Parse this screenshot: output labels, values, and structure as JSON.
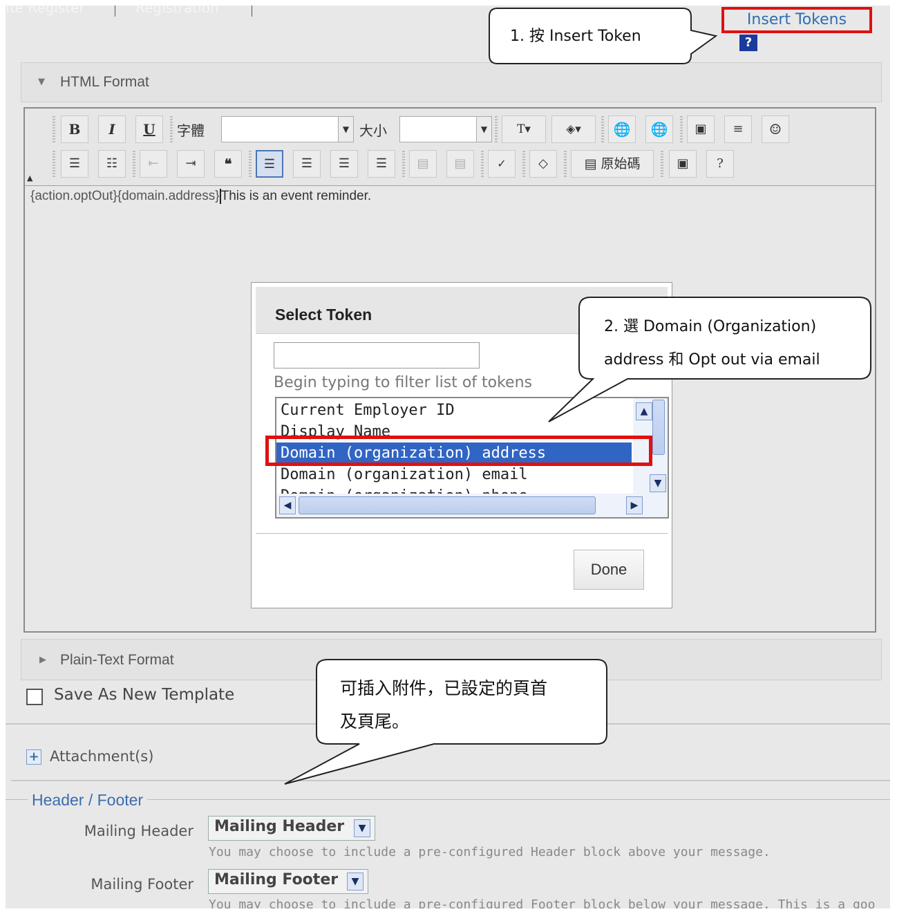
{
  "top_tabs": [
    "Ite Register",
    "Registration"
  ],
  "insert_tokens_label": "Insert Tokens",
  "help_icon_label": "?",
  "html_format_label": "HTML Format",
  "toolbar": {
    "bold": "B",
    "italic": "I",
    "underline": "U",
    "font_label": "字體",
    "size_label": "大小",
    "source_label": "原始碼",
    "quote": "❝"
  },
  "editor_content": {
    "token1": "{action.optOut}",
    "token2": "{domain.address}",
    "text": "This is an event reminder."
  },
  "dialog": {
    "title": "Select Token",
    "filter_value": "",
    "filter_hint": "Begin typing to filter list of tokens",
    "items": [
      "Current Employer ID",
      "Display Name",
      "Domain (organization) address",
      "Domain (organization) email",
      "Domain (organization) phone"
    ],
    "selected_index": 2,
    "done_label": "Done"
  },
  "callouts": {
    "c1": "1. 按 Insert Token",
    "c2_line1": "2. 選 Domain (Organization)",
    "c2_line2": "address 和 Opt out via email",
    "c3_line1": "可插入附件，已設定的頁首",
    "c3_line2": "及頁尾。"
  },
  "plain_text_label": "Plain-Text Format",
  "save_template_label": "Save As New Template",
  "attachments_label": "Attachment(s)",
  "header_footer": {
    "legend": "Header / Footer",
    "header_label": "Mailing Header",
    "header_value": "Mailing Header",
    "header_help": "You may choose to include a pre-configured Header block above your message.",
    "footer_label": "Mailing Footer",
    "footer_value": "Mailing Footer",
    "footer_help": "You may choose to include a pre-configured Footer block below your message. This is a goo"
  },
  "colors": {
    "highlight_red": "#e01010",
    "selection_blue": "#3165c4",
    "link_blue": "#2f6db3"
  }
}
